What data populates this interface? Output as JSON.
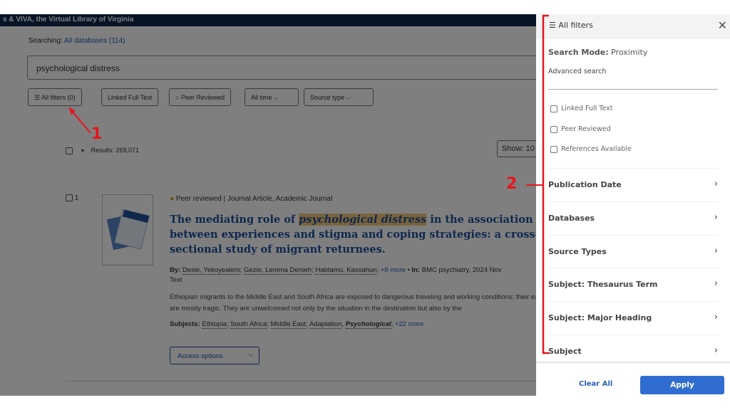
{
  "header": {
    "title": "s & VIVA, the Virtual Library of Virginia"
  },
  "search": {
    "searching_label": "Searching:",
    "databases": "All databases (114)",
    "query": "psychological distress"
  },
  "chips": [
    {
      "label": "All filters (0)"
    },
    {
      "label": "Linked Full Text"
    },
    {
      "label": "Peer Reviewed"
    },
    {
      "label": "All time"
    },
    {
      "label": "Source type"
    }
  ],
  "results": {
    "count": "Results: 269,071",
    "show": "Show: 10"
  },
  "result": {
    "index": "1",
    "badge": "Peer reviewed",
    "type": "Journal Article, Academic Journal",
    "title_pre": "The mediating role of ",
    "title_hl": "psychological distress",
    "title_post": " in the association between experiences and stigma and coping strategies: a cross-sectional study of migrant returnees.",
    "by_label": "By:",
    "authors": [
      "Desie, Yekoyealem",
      "Gezie, Lemma Derseh",
      "Habtamu, Kassahun"
    ],
    "more_authors": "+8 more",
    "in_label": "In:",
    "source": "BMC psychiatry, 2024 Nov",
    "source_tail": "Text",
    "abstract": "Ethiopian migrants to the Middle East and South Africa are exposed to dangerous traveling and working conditions; their experiences are mostly tragic. They are unwelcomed not only by the situation in the destination but also by the",
    "subjects_label": "Subjects:",
    "subjects": [
      "Ethiopia",
      "South Africa",
      "Middle East",
      "Adaptation"
    ],
    "subject_bold": "Psychological",
    "more_subjects": "+22 more",
    "access": "Access options"
  },
  "panel": {
    "title": "All filters",
    "search_mode_label": "Search Mode:",
    "search_mode": "Proximity",
    "advanced": "Advanced search",
    "checkboxes": [
      "Linked Full Text",
      "Peer Reviewed",
      "References Available"
    ],
    "facets": [
      "Publication Date",
      "Databases",
      "Source Types",
      "Subject: Thesaurus Term",
      "Subject: Major Heading",
      "Subject"
    ],
    "clear": "Clear All",
    "apply": "Apply"
  },
  "annotations": {
    "one": "1",
    "two": "2"
  },
  "colors": {
    "accent": "#2f6dd0",
    "annotation": "#e8141b",
    "header": "#0b2a4a"
  }
}
